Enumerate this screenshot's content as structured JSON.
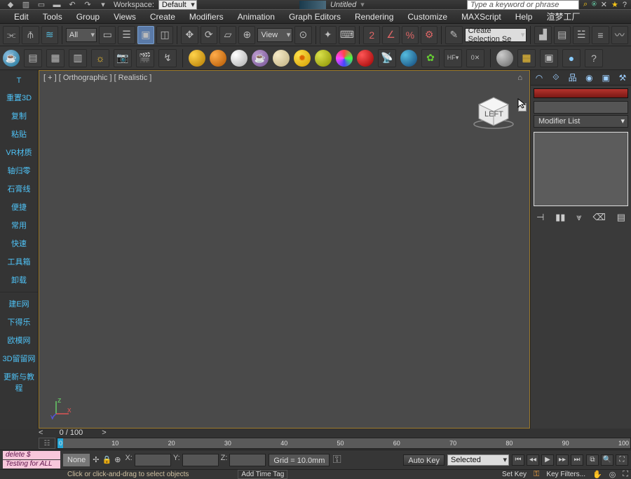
{
  "titlebar": {
    "workspace_label": "Workspace:",
    "workspace_value": "Default",
    "doc_title": "Untitled",
    "search_placeholder": "Type a keyword or phrase"
  },
  "menus": [
    "Edit",
    "Tools",
    "Group",
    "Views",
    "Create",
    "Modifiers",
    "Animation",
    "Graph Editors",
    "Rendering",
    "Customize",
    "MAXScript",
    "Help",
    "渲梦工厂"
  ],
  "toolbar1": {
    "selection_filter": "All",
    "view_label": "View",
    "named_sel": "Create Selection Se"
  },
  "sidebar": {
    "items": [
      "T",
      "重置3D",
      "复制",
      "粘贴",
      "VR材质",
      "轴归零",
      "石膏线",
      "便捷",
      "常用",
      "快速",
      "工具箱",
      "卸载",
      "建E网",
      "下得乐",
      "欧模网",
      "3D留留网",
      "更新与教程"
    ]
  },
  "viewport": {
    "label": "[ + ] [ Orthographic ] [ Realistic ]"
  },
  "right_panel": {
    "modifier_list_label": "Modifier List"
  },
  "timeline": {
    "frame_display": "0 / 100",
    "ticks": [
      "0",
      "10",
      "20",
      "30",
      "40",
      "50",
      "60",
      "70",
      "80",
      "90",
      "100"
    ]
  },
  "status": {
    "scripts": [
      "delete $",
      "Testing for ALL"
    ],
    "none_label": "None",
    "x_label": "X:",
    "y_label": "Y:",
    "z_label": "Z:",
    "grid_label": "Grid = 10.0mm",
    "autokey_label": "Auto Key",
    "selected_label": "Selected",
    "setkey_label": "Set Key",
    "keyfilters_label": "Key Filters...",
    "add_timetag": "Add Time Tag",
    "prompt": "Click or click-and-drag to select objects"
  },
  "chart_data": null
}
